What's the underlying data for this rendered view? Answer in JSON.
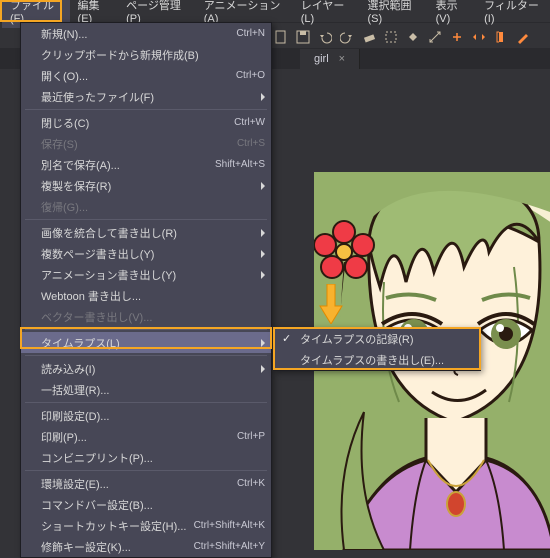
{
  "menubar": {
    "items": [
      {
        "label": "ファイル(F)",
        "active": true
      },
      {
        "label": "編集(E)"
      },
      {
        "label": "ページ管理(P)"
      },
      {
        "label": "アニメーション(A)"
      },
      {
        "label": "レイヤー(L)"
      },
      {
        "label": "選択範囲(S)"
      },
      {
        "label": "表示(V)"
      },
      {
        "label": "フィルター(I)"
      }
    ]
  },
  "tab": {
    "label": "girl",
    "close": "×"
  },
  "file_menu": {
    "items": [
      {
        "label": "新規(N)...",
        "shortcut": "Ctrl+N"
      },
      {
        "label": "クリップボードから新規作成(B)"
      },
      {
        "label": "開く(O)...",
        "shortcut": "Ctrl+O"
      },
      {
        "label": "最近使ったファイル(F)",
        "submenu": true
      },
      {
        "sep": true
      },
      {
        "label": "閉じる(C)",
        "shortcut": "Ctrl+W"
      },
      {
        "label": "保存(S)",
        "shortcut": "Ctrl+S",
        "disabled": true
      },
      {
        "label": "別名で保存(A)...",
        "shortcut": "Shift+Alt+S"
      },
      {
        "label": "複製を保存(R)",
        "submenu": true
      },
      {
        "label": "復帰(G)...",
        "disabled": true
      },
      {
        "sep": true
      },
      {
        "label": "画像を統合して書き出し(R)",
        "submenu": true
      },
      {
        "label": "複数ページ書き出し(Y)",
        "submenu": true
      },
      {
        "label": "アニメーション書き出し(Y)",
        "submenu": true
      },
      {
        "label": "Webtoon 書き出し..."
      },
      {
        "label": "ベクター書き出し(V)...",
        "disabled": true
      },
      {
        "sep": true
      },
      {
        "label": "タイムラプス(L)",
        "submenu": true,
        "hover": true
      },
      {
        "sep": true
      },
      {
        "label": "読み込み(I)",
        "submenu": true
      },
      {
        "label": "一括処理(R)..."
      },
      {
        "sep": true
      },
      {
        "label": "印刷設定(D)..."
      },
      {
        "label": "印刷(P)...",
        "shortcut": "Ctrl+P"
      },
      {
        "label": "コンビニプリント(P)..."
      },
      {
        "sep": true
      },
      {
        "label": "環境設定(E)...",
        "shortcut": "Ctrl+K"
      },
      {
        "label": "コマンドバー設定(B)..."
      },
      {
        "label": "ショートカットキー設定(H)...",
        "shortcut": "Ctrl+Shift+Alt+K"
      },
      {
        "label": "修飾キー設定(K)...",
        "shortcut": "Ctrl+Shift+Alt+Y"
      }
    ]
  },
  "submenu": {
    "items": [
      {
        "label": "タイムラプスの記録(R)",
        "checked": true
      },
      {
        "label": "タイムラプスの書き出し(E)..."
      }
    ]
  },
  "icons": {
    "toolbar": [
      "file-icon",
      "save-icon",
      "undo-icon",
      "redo-icon",
      "erase-icon",
      "clip-icon",
      "fill-icon",
      "scale-icon",
      "rotate-icon",
      "flip-icon",
      "flipv-icon",
      "pen-icon"
    ]
  }
}
